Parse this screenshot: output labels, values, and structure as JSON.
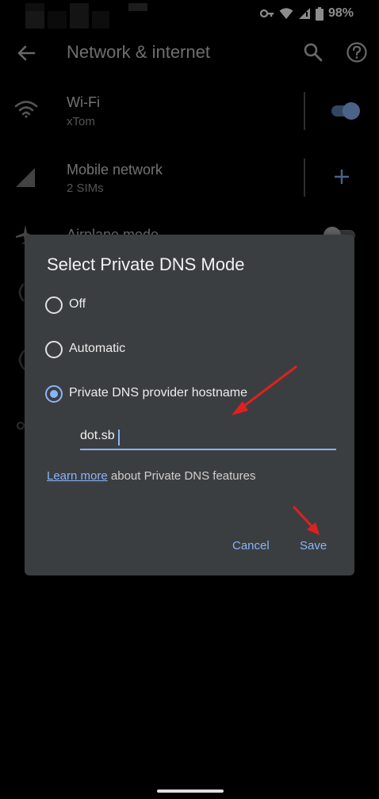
{
  "status": {
    "battery_text": "98%"
  },
  "appbar": {
    "title": "Network & internet"
  },
  "settings": [
    {
      "title": "Wi-Fi",
      "subtitle": "xTom",
      "icon": "wifi-icon",
      "control": "toggle-on"
    },
    {
      "title": "Mobile network",
      "subtitle": "2 SIMs",
      "icon": "signal-icon",
      "control": "add-icon"
    },
    {
      "title": "Airplane mode",
      "icon": "airplane-icon",
      "control": "toggle-off"
    }
  ],
  "dialog": {
    "title": "Select Private DNS Mode",
    "options": [
      {
        "label": "Off",
        "checked": false
      },
      {
        "label": "Automatic",
        "checked": false
      },
      {
        "label": "Private DNS provider hostname",
        "checked": true
      }
    ],
    "hostname_value": "dot.sb",
    "learn_link": "Learn more",
    "learn_suffix": " about Private DNS features",
    "cancel_label": "Cancel",
    "save_label": "Save"
  },
  "colors": {
    "accent": "#8ab4f8",
    "dialog_bg": "#3b3e40",
    "annotation_red": "#e02020"
  }
}
